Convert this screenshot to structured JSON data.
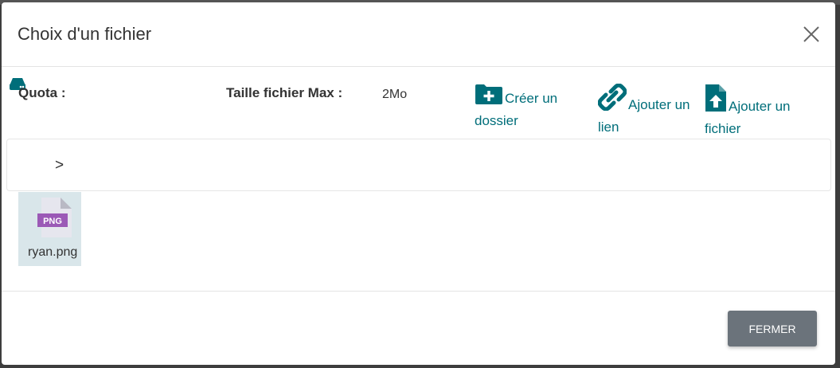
{
  "dialog": {
    "title": "Choix d'un fichier",
    "close_icon": "close-icon"
  },
  "info": {
    "quota_label": "Quota :",
    "max_size_label": "Taille fichier Max :",
    "max_size_value": "2Mo"
  },
  "actions": {
    "create_folder": "Créer un dossier",
    "add_link": "Ajouter un lien",
    "add_file": "Ajouter un fichier"
  },
  "breadcrumb": {
    "separator": ">"
  },
  "files": [
    {
      "name": "ryan.png",
      "type_badge": "PNG",
      "icon": "png-file-icon"
    }
  ],
  "footer": {
    "close_label": "FERMER"
  },
  "colors": {
    "accent": "#006e7a",
    "tile_bg": "#d9e6ea",
    "png_badge": "#9b59b6",
    "button_bg": "#6b737b"
  }
}
